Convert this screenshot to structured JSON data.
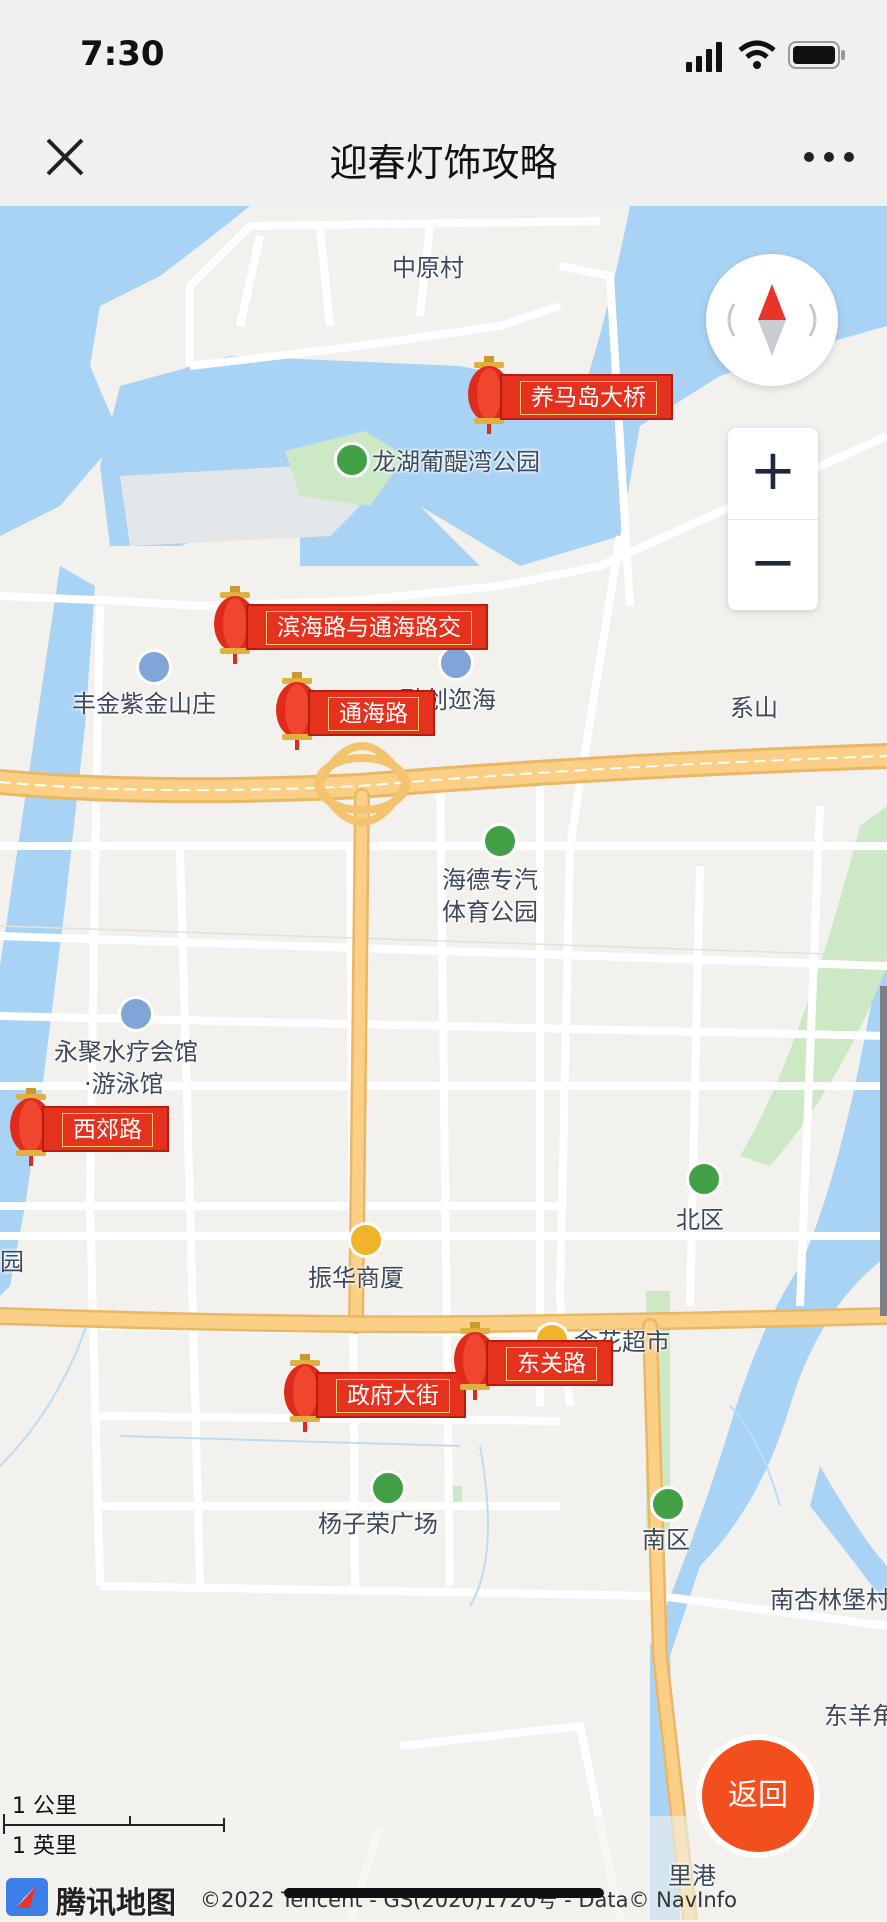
{
  "status_bar": {
    "time": "7:30"
  },
  "nav": {
    "title": "迎春灯饰攻略"
  },
  "map": {
    "place_labels": [
      {
        "id": "zhongyuancun",
        "text": "中原村"
      },
      {
        "id": "longhu",
        "text": "龙湖葡醍湾公园"
      },
      {
        "id": "fengjin",
        "text": "丰金紫金山庄"
      },
      {
        "id": "rongchuang",
        "text": "融创迩海"
      },
      {
        "id": "xishan",
        "text": "系山"
      },
      {
        "id": "haide1",
        "text": "海德专汽"
      },
      {
        "id": "haide2",
        "text": "体育公园"
      },
      {
        "id": "yongju1",
        "text": "永聚水疗会馆"
      },
      {
        "id": "yongju2",
        "text": "·游泳馆"
      },
      {
        "id": "yuan",
        "text": "园"
      },
      {
        "id": "beiqu",
        "text": "北区"
      },
      {
        "id": "zhenhua",
        "text": "振华商厦"
      },
      {
        "id": "jinhua",
        "text": "金花超市"
      },
      {
        "id": "yangzirong",
        "text": "杨子荣广场"
      },
      {
        "id": "nanqu",
        "text": "南区"
      },
      {
        "id": "nanxinglin",
        "text": "南杏林堡村"
      },
      {
        "id": "dongyang",
        "text": "东羊角"
      },
      {
        "id": "ligang",
        "text": "里港"
      }
    ],
    "lantern_markers": [
      {
        "id": "yangmadao",
        "text": "养马岛大桥"
      },
      {
        "id": "binhai",
        "text": "滨海路与通海路交"
      },
      {
        "id": "tonghai",
        "text": "通海路"
      },
      {
        "id": "xijiao",
        "text": "西郊路"
      },
      {
        "id": "dongguan",
        "text": "东关路"
      },
      {
        "id": "zhengfu",
        "text": "政府大街"
      }
    ],
    "controls": {
      "zoom_in": "+",
      "zoom_out": "−",
      "back": "返回"
    },
    "scale": {
      "metric": "1 公里",
      "imperial": "1 英里"
    },
    "attribution": {
      "logo": "腾讯地图",
      "copyright": "©2022 Tencent - GS(2020)1720号 - Data© NavInfo"
    },
    "colors": {
      "water": "#a9d3f5",
      "land": "#f2f1ed",
      "road_major": "#fbcf86",
      "park": "#cde8c5",
      "marker_red": "#e5321f",
      "back_button": "#f24e1e"
    }
  }
}
